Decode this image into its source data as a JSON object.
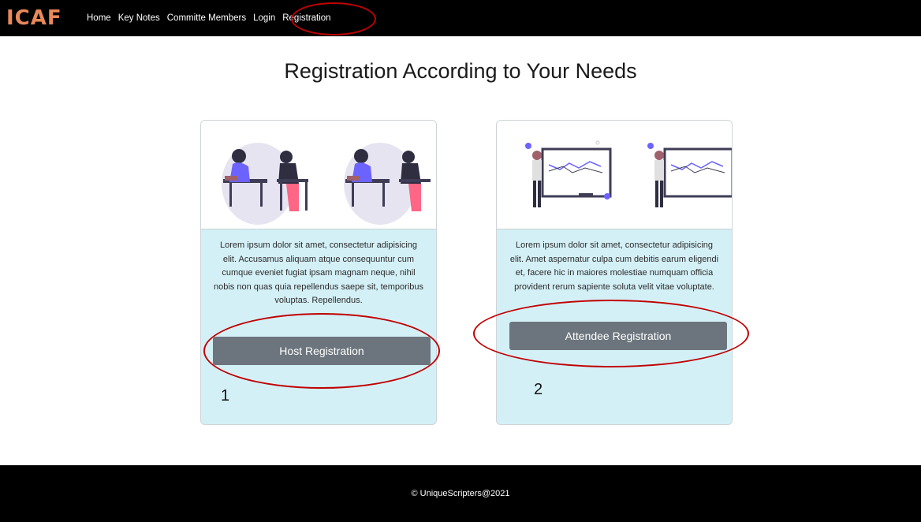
{
  "navbar": {
    "brand": "ICAF",
    "links": [
      "Home",
      "Key Notes",
      "Committe Members",
      "Login",
      "Registration"
    ],
    "active_link": "Registration"
  },
  "title": "Registration According to Your Needs",
  "cards": [
    {
      "image": "people-studying-at-desks-illustration",
      "text": "Lorem ipsum dolor sit amet, consectetur adipisicing elit. Accusamus aliquam atque consequuntur cum cumque eveniet fugiat ipsam magnam neque, nihil nobis non quas quia repellendus saepe sit, temporibus voluptas. Repellendus.",
      "button": "Host Registration",
      "step": "1"
    },
    {
      "image": "presenter-at-whiteboard-illustration",
      "text": "Lorem ipsum dolor sit amet, consectetur adipisicing elit. Amet aspernatur culpa cum debitis earum eligendi et, facere hic in maiores molestiae numquam officia provident rerum sapiente soluta velit vitae voluptate.",
      "button": "Attendee Registration",
      "step": "2"
    }
  ],
  "footer": {
    "text": "© UniqueScripters@2021"
  },
  "colors": {
    "navbar_bg": "#000000",
    "brand": "#e8895a",
    "card_bg": "#d4f0f7",
    "button_bg": "#6c757d",
    "annotation": "#c00000"
  }
}
